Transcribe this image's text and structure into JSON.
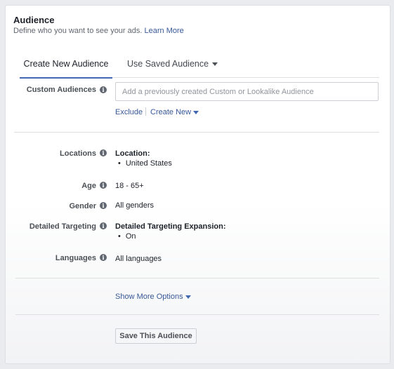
{
  "audience": {
    "title": "Audience",
    "subtitle": "Define who you want to see your ads.",
    "learn_more": "Learn More"
  },
  "tabs": [
    {
      "label": "Create New Audience",
      "active": true
    },
    {
      "label": "Use Saved Audience",
      "active": false
    }
  ],
  "custom_audiences": {
    "label": "Custom Audiences",
    "placeholder": "Add a previously created Custom or Lookalike Audience",
    "exclude": "Exclude",
    "create_new": "Create New"
  },
  "locations": {
    "label": "Locations",
    "heading": "Location:",
    "items": [
      "United States"
    ]
  },
  "age": {
    "label": "Age",
    "value": "18 - 65+"
  },
  "gender": {
    "label": "Gender",
    "value": "All genders"
  },
  "detailed_targeting": {
    "label": "Detailed Targeting",
    "heading": "Detailed Targeting Expansion:",
    "items": [
      "On"
    ]
  },
  "languages": {
    "label": "Languages",
    "value": "All languages"
  },
  "show_more": "Show More Options",
  "save_button": "Save This Audience",
  "icons": {
    "info": "info-icon",
    "dropdown": "caret-down-icon"
  },
  "colors": {
    "accent": "#4267b2",
    "link": "#385898"
  }
}
